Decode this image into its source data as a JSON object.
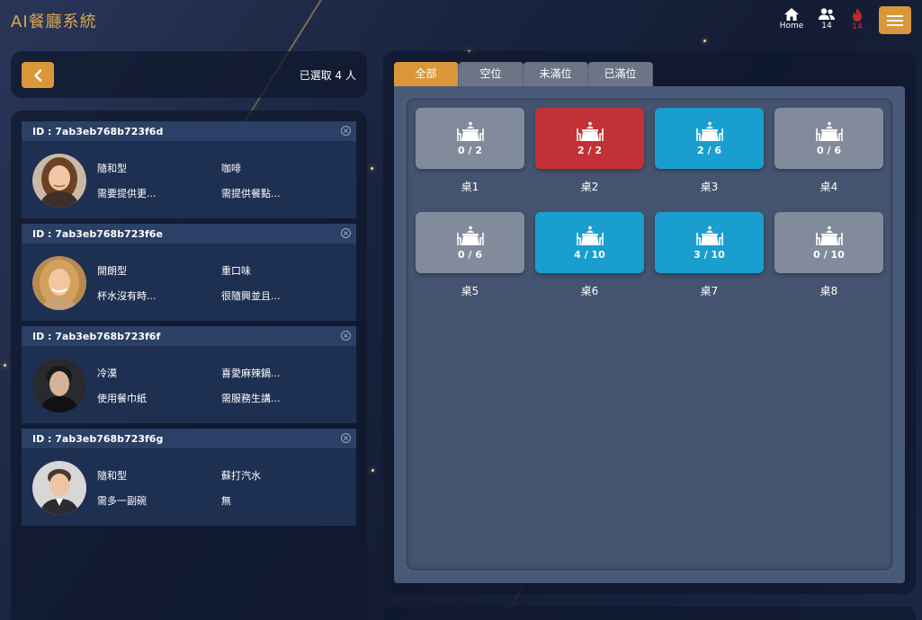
{
  "app": {
    "title": "AI餐廳系統"
  },
  "topnav": {
    "home_label": "Home",
    "people_count": "14",
    "alert_count": "14"
  },
  "selection": {
    "summary": "已選取 4 人"
  },
  "customers": [
    {
      "id_label": "ID : 7ab3eb768b723f6d",
      "traits": [
        "隨和型",
        "咖啡",
        "需要提供更...",
        "需提供餐點..."
      ]
    },
    {
      "id_label": "ID : 7ab3eb768b723f6e",
      "traits": [
        "開朗型",
        "重口味",
        "杯水沒有時...",
        "很隨興並且..."
      ]
    },
    {
      "id_label": "ID : 7ab3eb768b723f6f",
      "traits": [
        "冷漠",
        "喜愛麻辣鍋...",
        "使用餐巾紙",
        "需服務生講..."
      ]
    },
    {
      "id_label": "ID : 7ab3eb768b723f6g",
      "traits": [
        "隨和型",
        "蘇打汽水",
        "需多一副碗",
        "無"
      ]
    }
  ],
  "tabs": [
    "全部",
    "空位",
    "未滿位",
    "已滿位"
  ],
  "tables": [
    {
      "name": "桌1",
      "occupancy": "0 / 2",
      "status": "empty"
    },
    {
      "name": "桌2",
      "occupancy": "2 / 2",
      "status": "full"
    },
    {
      "name": "桌3",
      "occupancy": "2 / 6",
      "status": "partial"
    },
    {
      "name": "桌4",
      "occupancy": "0 / 6",
      "status": "empty"
    },
    {
      "name": "桌5",
      "occupancy": "0 / 6",
      "status": "empty"
    },
    {
      "name": "桌6",
      "occupancy": "4 / 10",
      "status": "partial"
    },
    {
      "name": "桌7",
      "occupancy": "3 / 10",
      "status": "partial"
    },
    {
      "name": "桌8",
      "occupancy": "0 / 10",
      "status": "empty"
    }
  ],
  "colors": {
    "accent": "#d9973a",
    "title_gold": "#d9a956",
    "status_empty": "#818b9c",
    "status_full": "#c23135",
    "status_partial": "#1a9ed0"
  },
  "icons": {
    "home": "home-icon",
    "people": "people-icon",
    "alert": "flame-icon",
    "menu": "hamburger-menu-icon",
    "back": "chevron-left-icon",
    "table": "dining-table-icon",
    "close": "close-circle-icon"
  }
}
